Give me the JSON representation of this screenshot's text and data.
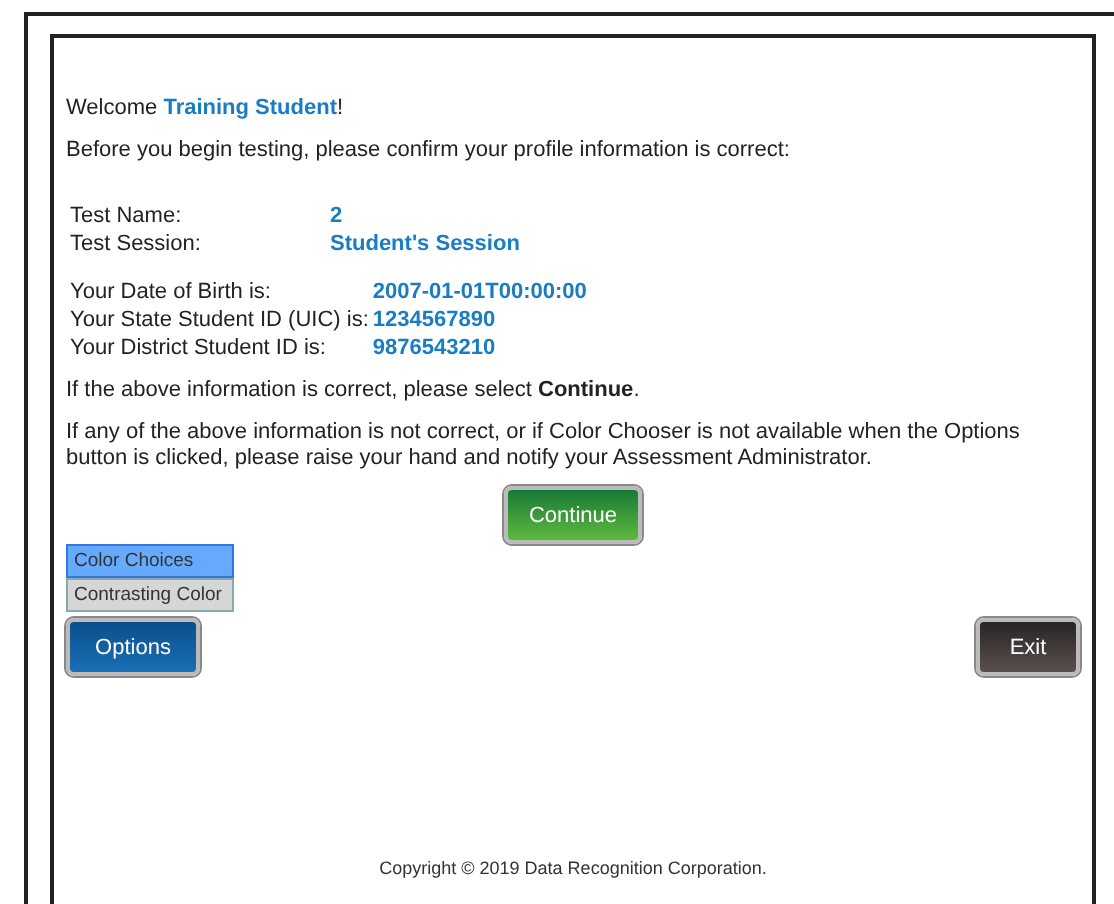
{
  "welcome": "Welcome **Training Student**!",
  "intro": "Before you begin testing, please confirm your profile information is correct:",
  "test_info": [
    {
      "label": "Test Name:",
      "value": "2"
    },
    {
      "label": "Test Session:",
      "value": "Student's Session"
    }
  ],
  "student_info": [
    {
      "label": "Your Date of Birth is:",
      "value": "2007-01-01T00:00:00"
    },
    {
      "label": "Your State Student ID (UIC) is:",
      "value": "1234567890"
    },
    {
      "label": "Your District Student ID is:",
      "value": "9876543210"
    }
  ],
  "confirm_text": "If the above information is correct, please select **Continue**.",
  "help_text": "If any of the above information is not correct, or if Color Chooser is not available when the Options button is clicked, please raise your hand and notify your Assessment Administrator.",
  "continue_button": "Continue",
  "options_menu": [
    {
      "label": "Color Choices",
      "selected": true
    },
    {
      "label": "Contrasting Color",
      "selected": false
    }
  ],
  "options_button": "Options",
  "exit_button": "Exit",
  "copyright": "Copyright © 2019 Data Recognition Corporation."
}
